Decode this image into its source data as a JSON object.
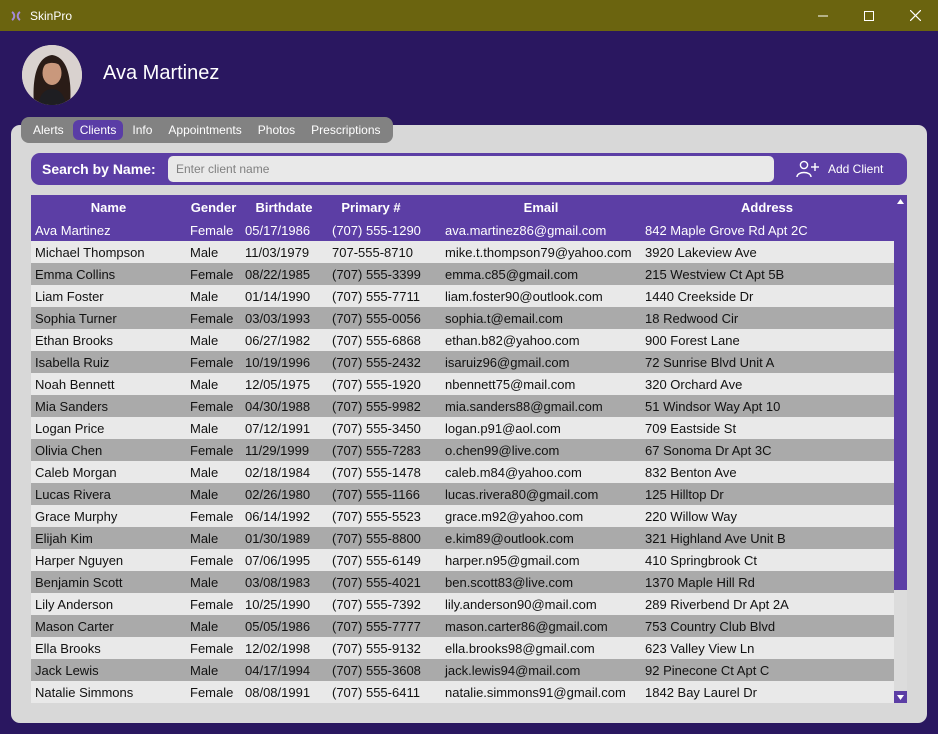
{
  "window": {
    "title": "SkinPro",
    "controls": [
      "minimize-icon",
      "maximize-icon",
      "close-icon"
    ]
  },
  "header": {
    "name": "Ava Martinez"
  },
  "tabs": [
    {
      "label": "Alerts",
      "active": false
    },
    {
      "label": "Clients",
      "active": true
    },
    {
      "label": "Info",
      "active": false
    },
    {
      "label": "Appointments",
      "active": false
    },
    {
      "label": "Photos",
      "active": false
    },
    {
      "label": "Prescriptions",
      "active": false
    }
  ],
  "search": {
    "label": "Search by Name:",
    "placeholder": "Enter client name",
    "value": ""
  },
  "add_client_label": "Add Client",
  "table": {
    "columns": [
      "Name",
      "Gender",
      "Birthdate",
      "Primary #",
      "Email",
      "Address"
    ],
    "selected_index": 0,
    "rows": [
      [
        "Ava Martinez",
        "Female",
        "05/17/1986",
        "(707) 555-1290",
        "ava.martinez86@gmail.com",
        "842 Maple Grove Rd Apt 2C"
      ],
      [
        "Michael Thompson",
        "Male",
        "11/03/1979",
        "707-555-8710",
        "mike.t.thompson79@yahoo.com",
        "3920 Lakeview Ave"
      ],
      [
        "Emma Collins",
        "Female",
        "08/22/1985",
        "(707) 555-3399",
        "emma.c85@gmail.com",
        "215 Westview Ct Apt 5B"
      ],
      [
        "Liam Foster",
        "Male",
        "01/14/1990",
        "(707) 555-7711",
        "liam.foster90@outlook.com",
        "1440 Creekside Dr"
      ],
      [
        "Sophia Turner",
        "Female",
        "03/03/1993",
        "(707) 555-0056",
        "sophia.t@email.com",
        "18 Redwood Cir"
      ],
      [
        "Ethan Brooks",
        "Male",
        "06/27/1982",
        "(707) 555-6868",
        "ethan.b82@yahoo.com",
        "900 Forest Lane"
      ],
      [
        "Isabella Ruiz",
        "Female",
        "10/19/1996",
        "(707) 555-2432",
        "isaruiz96@gmail.com",
        "72 Sunrise Blvd Unit A"
      ],
      [
        "Noah Bennett",
        "Male",
        "12/05/1975",
        "(707) 555-1920",
        "nbennett75@mail.com",
        "320 Orchard Ave"
      ],
      [
        "Mia Sanders",
        "Female",
        "04/30/1988",
        "(707) 555-9982",
        "mia.sanders88@gmail.com",
        "51 Windsor Way Apt 10"
      ],
      [
        "Logan Price",
        "Male",
        "07/12/1991",
        "(707) 555-3450",
        "logan.p91@aol.com",
        "709 Eastside St"
      ],
      [
        "Olivia Chen",
        "Female",
        "11/29/1999",
        "(707) 555-7283",
        "o.chen99@live.com",
        "67 Sonoma Dr Apt 3C"
      ],
      [
        "Caleb Morgan",
        "Male",
        "02/18/1984",
        "(707) 555-1478",
        "caleb.m84@yahoo.com",
        "832 Benton Ave"
      ],
      [
        "Lucas Rivera",
        "Male",
        "02/26/1980",
        "(707) 555-1166",
        "lucas.rivera80@gmail.com",
        "125 Hilltop Dr"
      ],
      [
        "Grace Murphy",
        "Female",
        "06/14/1992",
        "(707) 555-5523",
        "grace.m92@yahoo.com",
        "220 Willow Way"
      ],
      [
        "Elijah Kim",
        "Male",
        "01/30/1989",
        "(707) 555-8800",
        "e.kim89@outlook.com",
        "321 Highland Ave Unit B"
      ],
      [
        "Harper Nguyen",
        "Female",
        "07/06/1995",
        "(707) 555-6149",
        "harper.n95@gmail.com",
        "410 Springbrook Ct"
      ],
      [
        "Benjamin Scott",
        "Male",
        "03/08/1983",
        "(707) 555-4021",
        "ben.scott83@live.com",
        "1370 Maple Hill Rd"
      ],
      [
        "Lily Anderson",
        "Female",
        "10/25/1990",
        "(707) 555-7392",
        "lily.anderson90@mail.com",
        "289 Riverbend Dr Apt 2A"
      ],
      [
        "Mason Carter",
        "Male",
        "05/05/1986",
        "(707) 555-7777",
        "mason.carter86@gmail.com",
        "753 Country Club Blvd"
      ],
      [
        "Ella Brooks",
        "Female",
        "12/02/1998",
        "(707) 555-9132",
        "ella.brooks98@gmail.com",
        "623 Valley View Ln"
      ],
      [
        "Jack Lewis",
        "Male",
        "04/17/1994",
        "(707) 555-3608",
        "jack.lewis94@mail.com",
        "92 Pinecone Ct Apt C"
      ],
      [
        "Natalie Simmons",
        "Female",
        "08/08/1991",
        "(707) 555-6411",
        "natalie.simmons91@gmail.com",
        "1842 Bay Laurel Dr"
      ]
    ]
  },
  "colors": {
    "titlebar": "#6b640f",
    "background": "#2a1760",
    "accent": "#5c3ea5",
    "panel": "#d8d8d8",
    "row_dark": "#aaaaaa",
    "row_light": "#e9e9e9"
  }
}
